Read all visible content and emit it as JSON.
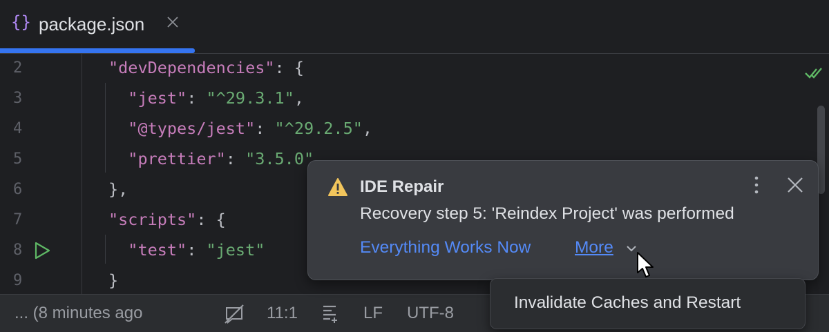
{
  "tab": {
    "icon": "{}",
    "title": "package.json",
    "close_icon": "close-icon"
  },
  "editor": {
    "line_numbers": [
      "2",
      "3",
      "4",
      "5",
      "6",
      "7",
      "8",
      "9"
    ],
    "lines": [
      {
        "tokens": [
          {
            "t": "\"devDependencies\"",
            "c": "k"
          },
          {
            "t": ": {",
            "c": "p"
          }
        ]
      },
      {
        "tokens": [
          {
            "t": "  \"jest\"",
            "c": "k"
          },
          {
            "t": ": ",
            "c": "p"
          },
          {
            "t": "\"^29.3.1\"",
            "c": "s"
          },
          {
            "t": ",",
            "c": "p"
          }
        ]
      },
      {
        "tokens": [
          {
            "t": "  \"@types/jest\"",
            "c": "k"
          },
          {
            "t": ": ",
            "c": "p"
          },
          {
            "t": "\"^29.2.5\"",
            "c": "s"
          },
          {
            "t": ",",
            "c": "p"
          }
        ]
      },
      {
        "tokens": [
          {
            "t": "  \"prettier\"",
            "c": "k"
          },
          {
            "t": ": ",
            "c": "p"
          },
          {
            "t": "\"3.5.0\"",
            "c": "s"
          }
        ]
      },
      {
        "tokens": [
          {
            "t": "},",
            "c": "p"
          }
        ]
      },
      {
        "tokens": [
          {
            "t": "\"scripts\"",
            "c": "k"
          },
          {
            "t": ": {",
            "c": "p"
          }
        ]
      },
      {
        "tokens": [
          {
            "t": "  \"test\"",
            "c": "k"
          },
          {
            "t": ": ",
            "c": "p"
          },
          {
            "t": "\"jest\"",
            "c": "s"
          }
        ]
      },
      {
        "tokens": [
          {
            "t": "}",
            "c": "p"
          }
        ]
      }
    ],
    "run_line": "8",
    "inspection_status_icon": "check-icon"
  },
  "statusbar": {
    "vcs_text": "... (8 minutes ago",
    "ai_icon": "no-assistant-icon",
    "caret_position": "11:1",
    "indent_icon": "indent-lines-icon",
    "line_separator": "LF",
    "encoding": "UTF-8"
  },
  "notification": {
    "icon": "warning-icon",
    "title": "IDE Repair",
    "body": "Recovery step 5: 'Reindex Project' was performed",
    "action_primary": "Everything Works Now",
    "action_more": "More",
    "more_icon": "chevron-down-icon",
    "menu_icon": "kebab-menu-icon",
    "close_icon": "close-icon"
  },
  "dropdown": {
    "items": [
      "Invalidate Caches and Restart"
    ]
  },
  "colors": {
    "background": "#1e1f22",
    "keyword": "#c77dbb",
    "string": "#6aab73",
    "link": "#548af7",
    "accent": "#3574f0",
    "warning": "#f2c55c"
  }
}
